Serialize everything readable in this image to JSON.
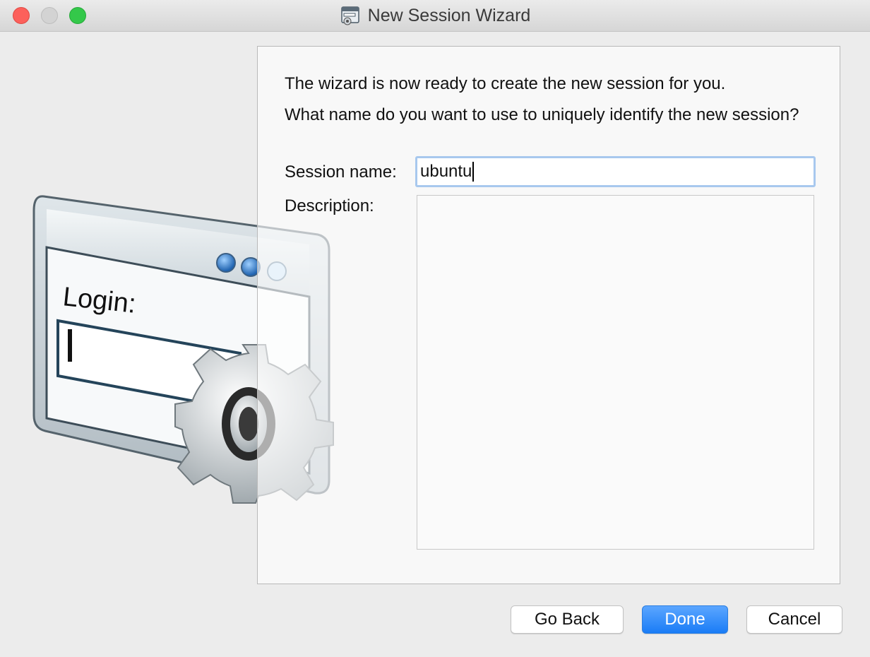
{
  "window": {
    "title": "New Session Wizard"
  },
  "illustration": {
    "login_label": "Login:"
  },
  "wizard": {
    "intro": "The wizard is now ready to create the new session for you.",
    "question": "What name do you want to use to uniquely identify the new session?",
    "session_name_label": "Session name:",
    "session_name_value": "ubuntu",
    "description_label": "Description:",
    "description_value": ""
  },
  "buttons": {
    "back": "Go Back",
    "done": "Done",
    "cancel": "Cancel"
  },
  "colors": {
    "close": "#fc605b",
    "maximize": "#34c84a",
    "primary_button": "#1a7cf6",
    "focus_ring": "#a8c8ee"
  }
}
